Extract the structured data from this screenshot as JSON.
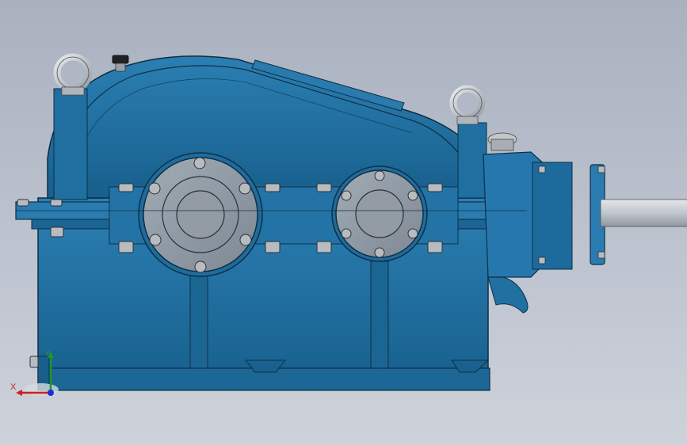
{
  "viewport": {
    "background_top": "#a9b1bf",
    "background_bottom": "#cdd2da"
  },
  "model": {
    "body_color": "#1c6a99",
    "edge_color": "#0f2f45",
    "cover_color": "#8a949e",
    "shaft_color": "#c7ccd2",
    "bolt_color": "#b8bcc0"
  },
  "triad": {
    "x_label": "X",
    "y_label": "Y",
    "x_color": "#d02020",
    "y_color": "#1a9a2a",
    "z_color": "#1a2fd0"
  }
}
